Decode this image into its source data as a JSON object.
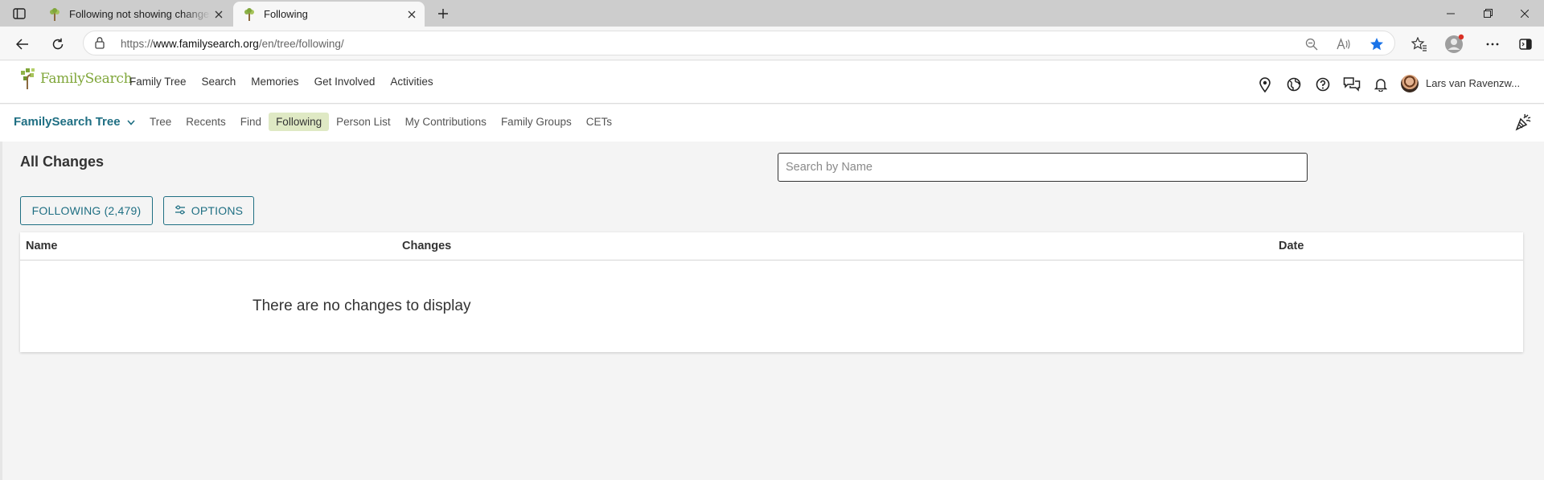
{
  "browser": {
    "tabs": [
      {
        "title": "Following not showing changes o",
        "active": false
      },
      {
        "title": "Following",
        "active": true
      }
    ],
    "url_prefix": "https://",
    "url_domain": "www.familysearch.org",
    "url_path": "/en/tree/following/"
  },
  "header": {
    "logo_text": "FamilySearch",
    "nav": [
      "Family Tree",
      "Search",
      "Memories",
      "Get Involved",
      "Activities"
    ],
    "user_name": "Lars van Ravenzw..."
  },
  "subnav": {
    "brand": "FamilySearch Tree",
    "items": [
      "Tree",
      "Recents",
      "Find",
      "Following",
      "Person List",
      "My Contributions",
      "Family Groups",
      "CETs"
    ],
    "active": "Following"
  },
  "main": {
    "title": "All Changes",
    "search_placeholder": "Search by Name",
    "following_button": "FOLLOWING (2,479)",
    "options_button": "OPTIONS",
    "table": {
      "columns": [
        "Name",
        "Changes",
        "Date"
      ],
      "empty_message": "There are no changes to display"
    }
  },
  "colors": {
    "brand_green": "#7fa639",
    "brand_teal": "#1f6f83",
    "active_tab_bg": "#dfe9c4",
    "favorite_star": "#1a73e8"
  }
}
